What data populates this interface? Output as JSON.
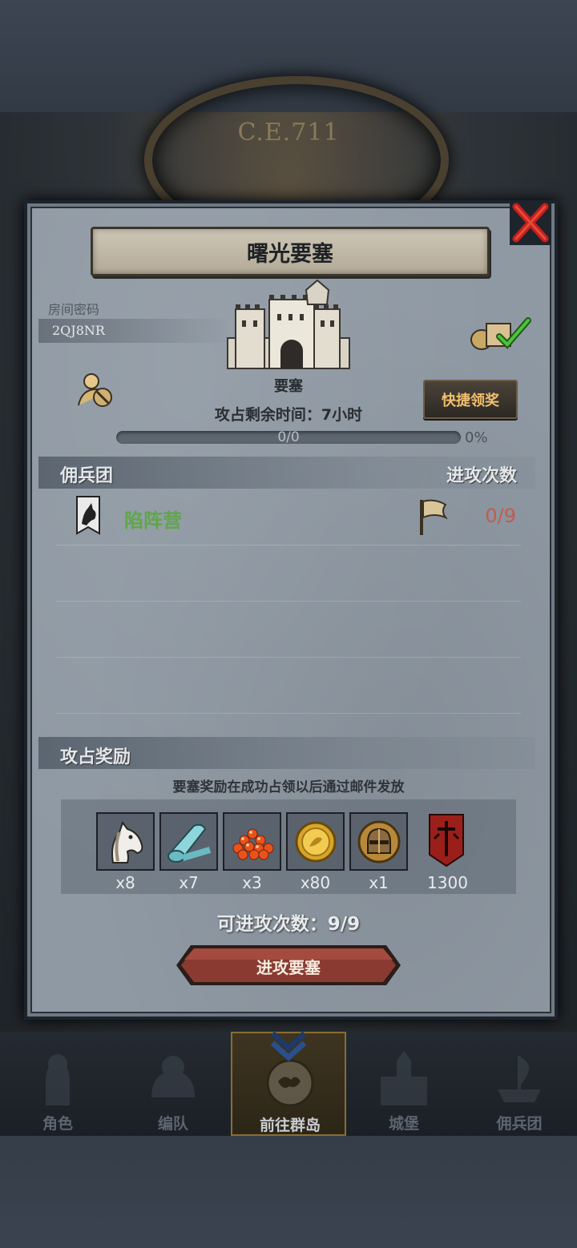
{
  "background": {
    "era_label": "C.E.711"
  },
  "dialog": {
    "title": "曙光要塞",
    "room_label": "房间密码",
    "room_code": "2QJ8NR",
    "fortress_name": "要塞",
    "time_left": "攻占剩余时间：7小时",
    "quick_claim_label": "快捷领奖",
    "progress": {
      "text": "0/0",
      "percent_label": "0%",
      "value": 0
    },
    "mercenary_section": {
      "title": "佣兵团",
      "right_label": "进攻次数"
    },
    "mercenaries": [
      {
        "name": "陷阵营",
        "count": "0/9"
      }
    ],
    "reward_section": {
      "title": "攻占奖励",
      "note": "要塞奖励在成功占领以后通过邮件发放",
      "items": [
        {
          "icon": "horse-icon",
          "qty": "x8"
        },
        {
          "icon": "cloth-roll-icon",
          "qty": "x7"
        },
        {
          "icon": "orange-gems-icon",
          "qty": "x3"
        },
        {
          "icon": "gold-coin-icon",
          "qty": "x80"
        },
        {
          "icon": "helmet-icon",
          "qty": "x1"
        },
        {
          "icon": "sword-banner-icon",
          "qty": "1300"
        }
      ]
    },
    "attempts_label": "可进攻次数：9/9",
    "attack_button_label": "进攻要塞"
  },
  "nav": {
    "items": [
      {
        "label": "角色",
        "icon": "knight-icon"
      },
      {
        "label": "编队",
        "icon": "helmet-group-icon"
      },
      {
        "label": "前往群岛",
        "icon": "island-compass-icon",
        "active": true
      },
      {
        "label": "城堡",
        "icon": "castle-icon"
      },
      {
        "label": "佣兵团",
        "icon": "ship-icon"
      }
    ]
  },
  "colors": {
    "panel": "#8f99a3",
    "merc_name": "#5fa64a",
    "attack_count": "#c35b4e",
    "claim_text": "#f1c06e",
    "attack_button": "#8a3a30"
  }
}
